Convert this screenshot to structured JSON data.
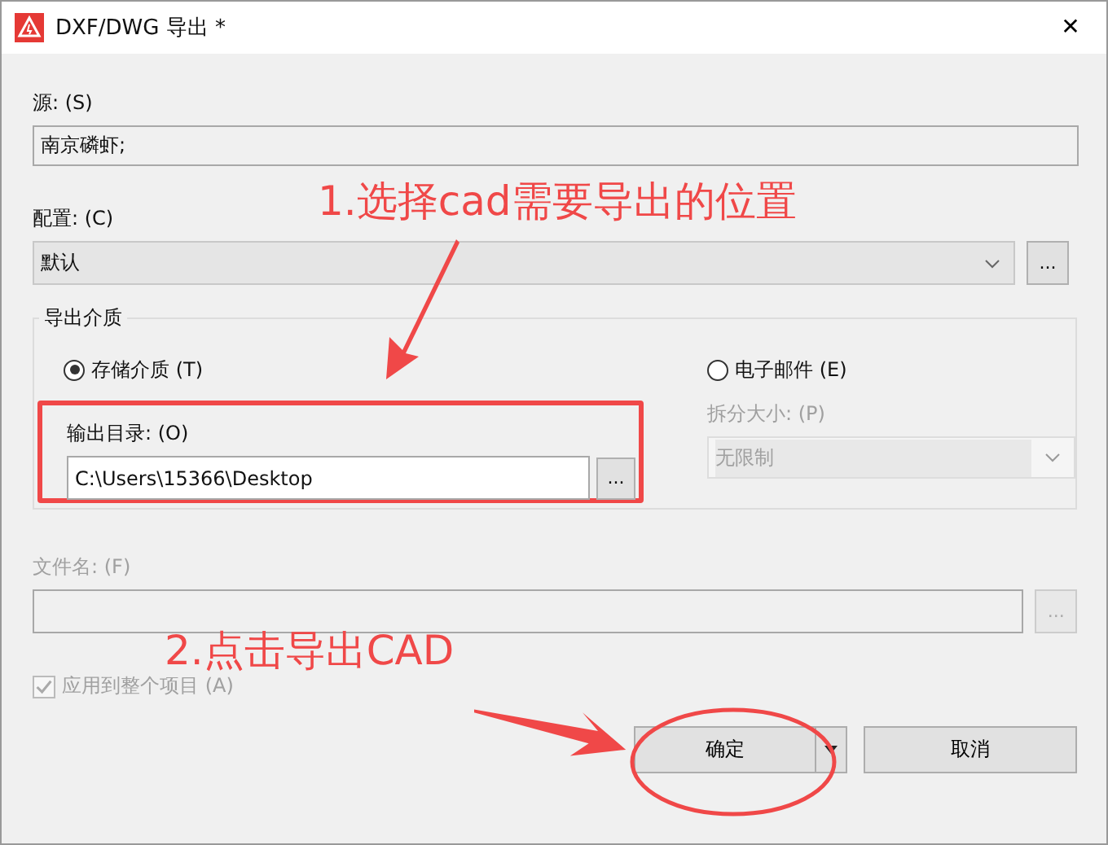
{
  "window": {
    "title": "DXF/DWG 导出 *",
    "close": "✕"
  },
  "source": {
    "label": "源: (S)",
    "value": "南京磷虾;"
  },
  "config": {
    "label": "配置: (C)",
    "value": "默认",
    "browse": "..."
  },
  "medium": {
    "title": "导出介质",
    "options": [
      {
        "label": "存储介质 (T)",
        "selected": true
      },
      {
        "label": "电子邮件 (E)",
        "selected": false
      }
    ],
    "output_dir": {
      "label": "输出目录: (O)",
      "value": "C:\\Users\\15366\\Desktop",
      "browse": "..."
    },
    "split_size": {
      "label": "拆分大小: (P)",
      "value": "无限制",
      "disabled": true
    }
  },
  "file_name": {
    "label": "文件名: (F)",
    "browse": "...",
    "disabled": true
  },
  "apply_all": {
    "label": "应用到整个项目 (A)",
    "checked": true,
    "disabled": true
  },
  "buttons": [
    {
      "label": "确定",
      "kind": "split"
    },
    {
      "label": "取消",
      "kind": "plain"
    }
  ],
  "annotations": [
    {
      "text": "1.选择cad需要导出的位置"
    },
    {
      "text": "2.点击导出CAD"
    }
  ]
}
